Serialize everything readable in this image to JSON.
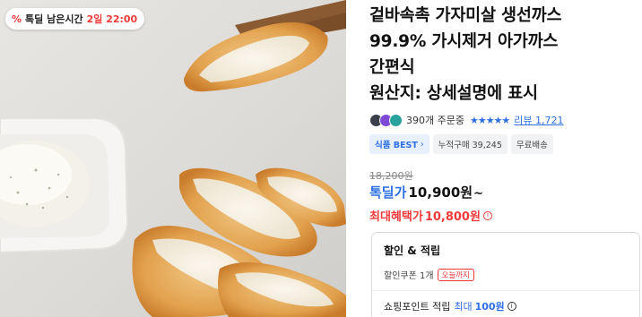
{
  "badge": {
    "icon": "percent-icon",
    "label": "톡딜 남은시간",
    "time": "2일 22:00"
  },
  "product": {
    "title_lines": [
      "겉바속촉 가자미살 생선까스",
      "99.9% 가시제거 아가까스",
      "간편식",
      "원산지: 상세설명에 표시"
    ]
  },
  "review": {
    "order_count": "390개 주문중",
    "stars": "★★★★★",
    "review_link": "리뷰 1,721"
  },
  "tags": [
    {
      "text": "식품 BEST",
      "chevron": "›"
    },
    {
      "text": "누적구매 39,245"
    },
    {
      "text": "무료배송"
    }
  ],
  "price": {
    "original": "18,200원",
    "deal_label": "톡딜가",
    "deal_amount": "10,900원",
    "deal_tilde": "~",
    "max_label": "최대혜택가",
    "max_amount": "10,800원",
    "info_glyph": "i"
  },
  "benefits": {
    "title": "할인 & 적립",
    "coupon_text": "할인쿠폰 1개",
    "coupon_badge": "오늘까지",
    "points_label": "쇼핑포인트 적립",
    "points_max": "최대",
    "points_value": "100원"
  },
  "colors": {
    "accent_red": "#f03a3a",
    "accent_blue": "#2f6fe4"
  }
}
